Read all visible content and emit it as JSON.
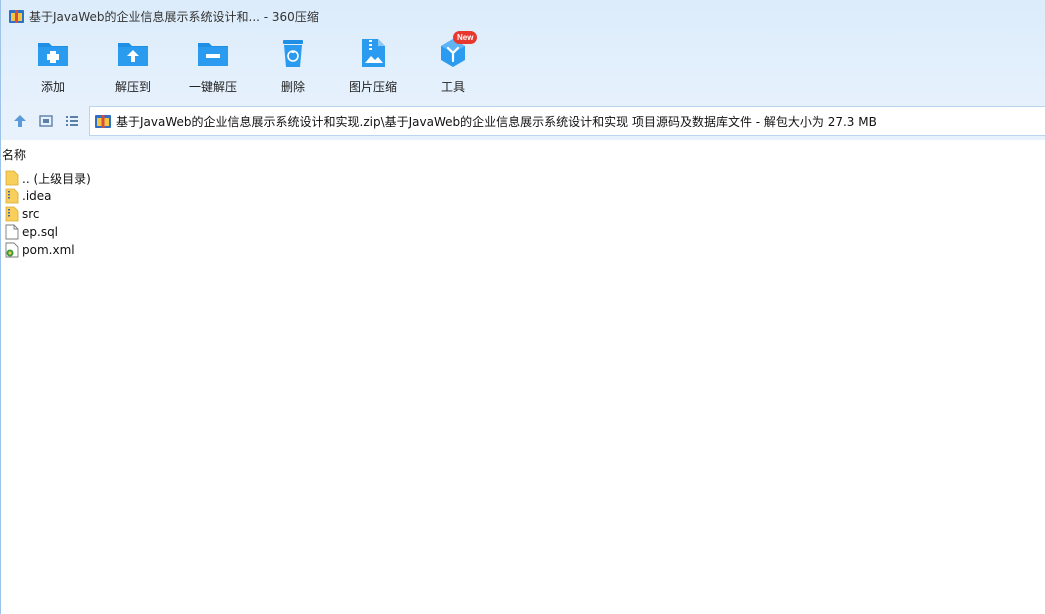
{
  "app": {
    "title": "基于JavaWeb的企业信息展示系统设计和... - 360压缩"
  },
  "toolbar": {
    "items": [
      {
        "label": "添加",
        "icon": "add-icon"
      },
      {
        "label": "解压到",
        "icon": "extract-to-icon"
      },
      {
        "label": "一键解压",
        "icon": "one-click-extract-icon"
      },
      {
        "label": "删除",
        "icon": "delete-icon"
      },
      {
        "label": "图片压缩",
        "icon": "image-compress-icon"
      },
      {
        "label": "工具",
        "icon": "tools-icon",
        "badge": "New"
      }
    ]
  },
  "nav": {
    "path": "基于JavaWeb的企业信息展示系统设计和实现.zip\\基于JavaWeb的企业信息展示系统设计和实现 项目源码及数据库文件 - 解包大小为 27.3 MB"
  },
  "list": {
    "column_name": "名称",
    "files": [
      {
        "name": ".. (上级目录)",
        "type": "parent-folder"
      },
      {
        "name": ".idea",
        "type": "folder"
      },
      {
        "name": "src",
        "type": "folder"
      },
      {
        "name": "ep.sql",
        "type": "file"
      },
      {
        "name": "pom.xml",
        "type": "xml"
      }
    ]
  },
  "colors": {
    "accent": "#1f8fe6",
    "header_bg": "#dcecfb",
    "folder": "#f7cf5a",
    "badge": "#e8372f"
  }
}
